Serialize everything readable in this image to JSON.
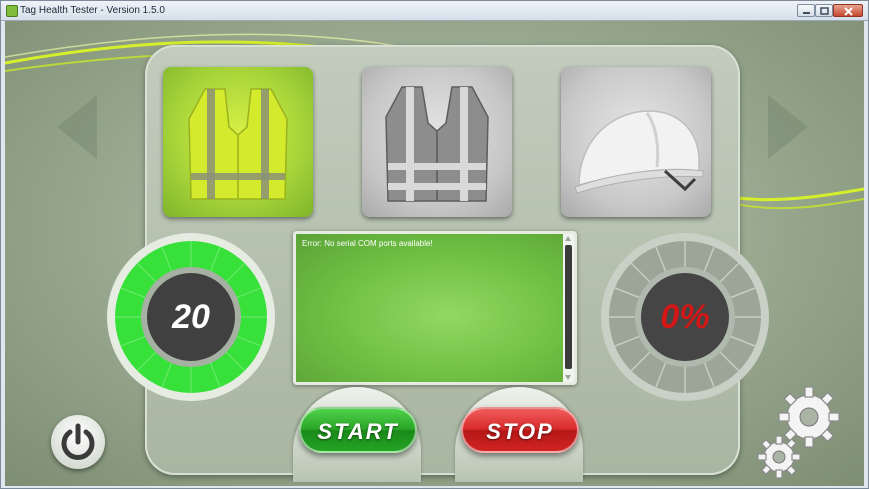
{
  "window": {
    "title": "Tag Health Tester - Version 1.5.0",
    "icon": "app-tag-icon"
  },
  "title_buttons": {
    "minimize": "minimize-icon",
    "maximize": "maximize-icon",
    "close": "close-icon"
  },
  "nav": {
    "prev_icon": "arrow-left-icon",
    "next_icon": "arrow-right-icon"
  },
  "cards": [
    {
      "item": "yellow safety vest",
      "selected": true,
      "icon": "safety-vest-icon"
    },
    {
      "item": "gray reflective vest",
      "selected": false,
      "icon": "reflective-vest-icon"
    },
    {
      "item": "hard hat",
      "selected": false,
      "icon": "hard-hat-icon"
    }
  ],
  "dial_left": {
    "value": "20",
    "fill_fraction": 1.0,
    "color": "#38e03a"
  },
  "dial_right": {
    "value": "0%",
    "fill_fraction": 0.0,
    "color": "#d51616"
  },
  "console": {
    "message": "Error: No serial COM ports available!"
  },
  "buttons": {
    "start": "START",
    "stop": "STOP"
  },
  "icons": {
    "power": "power-icon",
    "settings": "gears-icon"
  },
  "colors": {
    "accent_green": "#38e03a",
    "start": "#2aa628",
    "stop": "#d82a2a",
    "swoosh": "#d6ef2b"
  }
}
